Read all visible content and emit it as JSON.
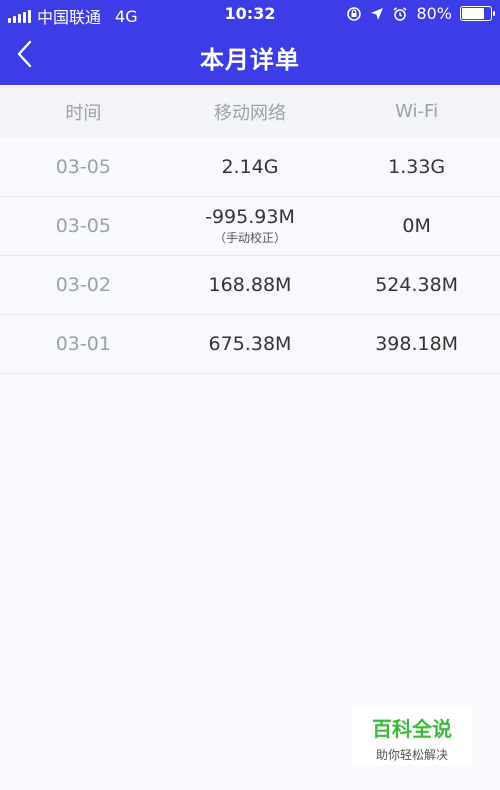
{
  "status_bar": {
    "carrier": "中国联通",
    "network": "4G",
    "time": "10:32",
    "battery": "80%"
  },
  "navbar": {
    "title": "本月详单"
  },
  "table": {
    "headers": [
      "时间",
      "移动网络",
      "Wi-Fi"
    ],
    "rows": [
      {
        "date": "03-05",
        "mobile": "2.14G",
        "mobile_note": "",
        "wifi": "1.33G"
      },
      {
        "date": "03-05",
        "mobile": "-995.93M",
        "mobile_note": "（手动校正）",
        "wifi": "0M"
      },
      {
        "date": "03-02",
        "mobile": "168.88M",
        "mobile_note": "",
        "wifi": "524.38M"
      },
      {
        "date": "03-01",
        "mobile": "675.38M",
        "mobile_note": "",
        "wifi": "398.18M"
      }
    ]
  },
  "watermark": {
    "brand": "百科全说",
    "sub": "助你轻松解决"
  },
  "colors": {
    "header_bg": "#3d3de8",
    "watermark_green": "#3cba3c"
  },
  "battery_level": 0.8
}
